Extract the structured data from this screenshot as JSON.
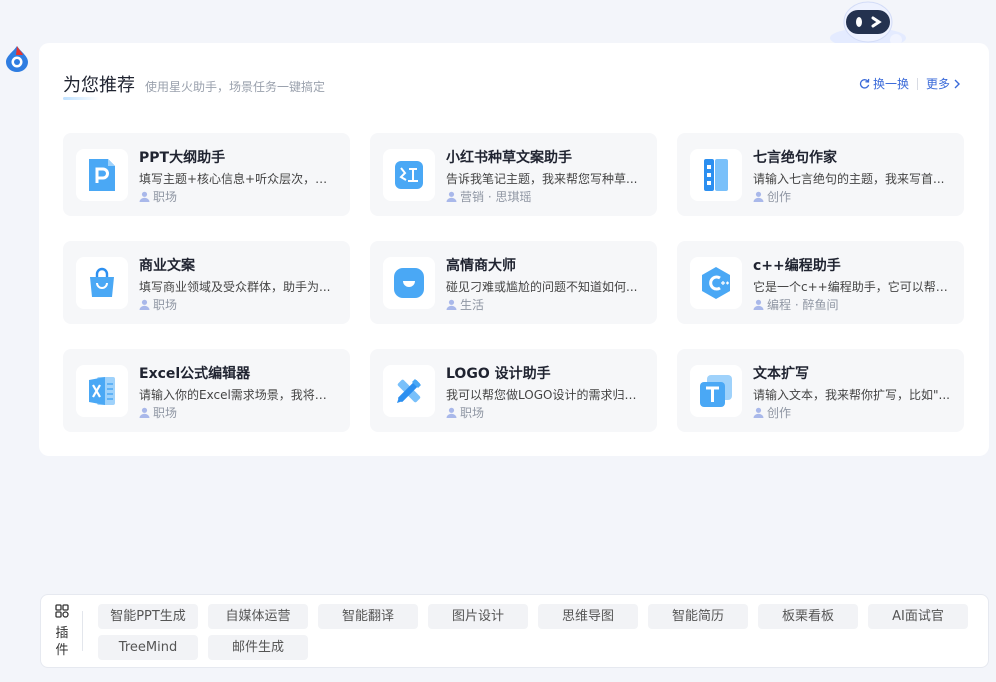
{
  "header": {
    "title": "为您推荐",
    "subtitle": "使用星火助手，场景任务一键搞定",
    "refresh_label": "换一换",
    "more_label": "更多"
  },
  "cards": [
    {
      "title": "PPT大纲助手",
      "desc": "填写主题+核心信息+听众层次，为...",
      "tags": "职场",
      "icon": "ppt-icon"
    },
    {
      "title": "小红书种草文案助手",
      "desc": "告诉我笔记主题，我来帮您写种草...",
      "tags": "营销 · 思琪瑶",
      "icon": "xiaohongshu-icon"
    },
    {
      "title": "七言绝句作家",
      "desc": "请输入七言绝句的主题，我来写首...",
      "tags": "创作",
      "icon": "book-icon"
    },
    {
      "title": "商业文案",
      "desc": "填写商业领域及受众群体，助手为...",
      "tags": "职场",
      "icon": "shopping-bag-icon"
    },
    {
      "title": "高情商大师",
      "desc": "碰见刁难或尴尬的问题不知道如何...",
      "tags": "生活",
      "icon": "smile-icon"
    },
    {
      "title": "c++编程助手",
      "desc": "它是一个c++编程助手，它可以帮你...",
      "tags": "编程 · 醉鱼间",
      "icon": "cpp-icon"
    },
    {
      "title": "Excel公式编辑器",
      "desc": "请输入你的Excel需求场景，我将给...",
      "tags": "职场",
      "icon": "excel-icon"
    },
    {
      "title": "LOGO 设计助手",
      "desc": "我可以帮您做LOGO设计的需求归纳...",
      "tags": "职场",
      "icon": "design-tools-icon"
    },
    {
      "title": "文本扩写",
      "desc": "请输入文本，我来帮你扩写，比如\"...",
      "tags": "创作",
      "icon": "text-t-icon"
    }
  ],
  "plugins": {
    "label": "插件",
    "items": [
      "智能PPT生成",
      "自媒体运营",
      "智能翻译",
      "图片设计",
      "思维导图",
      "智能简历",
      "板栗看板",
      "AI面试官",
      "TreeMind",
      "邮件生成"
    ]
  },
  "colors": {
    "accent": "#3a6ad9",
    "card_bg": "#f6f7f9",
    "page_bg": "#f3f5fa"
  }
}
